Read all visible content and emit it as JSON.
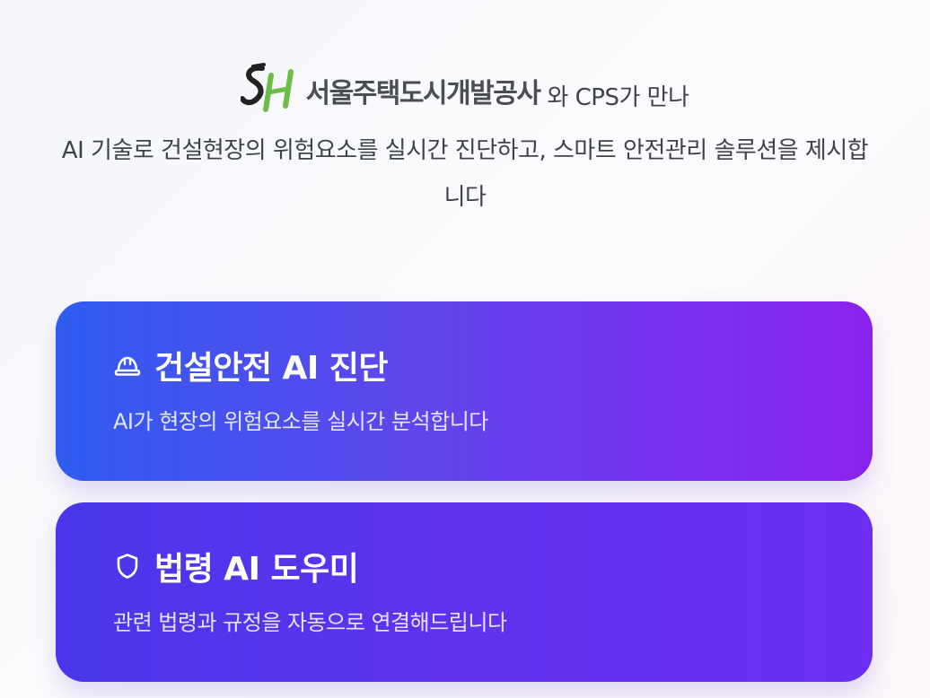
{
  "intro": {
    "brand_name": "서울주택도시개발공사",
    "brand_tail": "와 CPS가 만나",
    "description": "AI 기술로 건설현장의 위험요소를 실시간 진단하고, 스마트 안전관리 솔루션을 제시합니다",
    "logo_text": "SH",
    "logo_colors": {
      "s": "#222222",
      "h": "#6cbd45"
    }
  },
  "cards": [
    {
      "icon": "hard-hat-icon",
      "title": "건설안전 AI 진단",
      "description": "AI가 현장의 위험요소를 실시간 분석합니다"
    },
    {
      "icon": "shield-icon",
      "title": "법령 AI 도우미",
      "description": "관련 법령과 규정을 자동으로 연결해드립니다"
    }
  ]
}
